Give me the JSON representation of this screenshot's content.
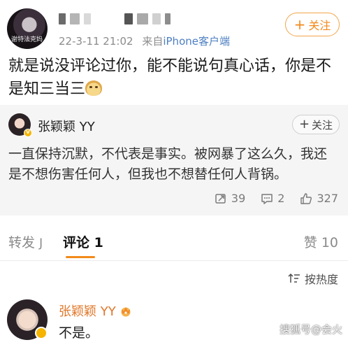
{
  "post": {
    "avatar_caption": "谢特法克妈",
    "meta_time": "22-3-11 21:02",
    "meta_from": "来自",
    "meta_source": "iPhone客户端",
    "follow_label": "关注",
    "text": "就是说没评论过你，能不能说句真心话，你是不是知三当三"
  },
  "quote": {
    "author": "张颖颖 YY",
    "follow_label": "关注",
    "text": "一直保持沉默，不代表是事实。被网暴了这么久，我还是不想伤害任何人，但我也不想替任何人背锅。",
    "reposts": "39",
    "comments": "2",
    "likes": "327"
  },
  "tabs": {
    "repost_label": "转发",
    "repost_count": "J",
    "comments_label": "评论",
    "comments_count": "1",
    "likes_label": "赞",
    "likes_count": "10"
  },
  "sort": {
    "label": "按热度"
  },
  "comment": {
    "author": "张颖颖 YY",
    "text": "不是。"
  },
  "watermark": "搜狐号@会火",
  "colors": {
    "accent": "#f28a1b",
    "link": "#4d7fc2",
    "comment_name": "#e0782a"
  }
}
